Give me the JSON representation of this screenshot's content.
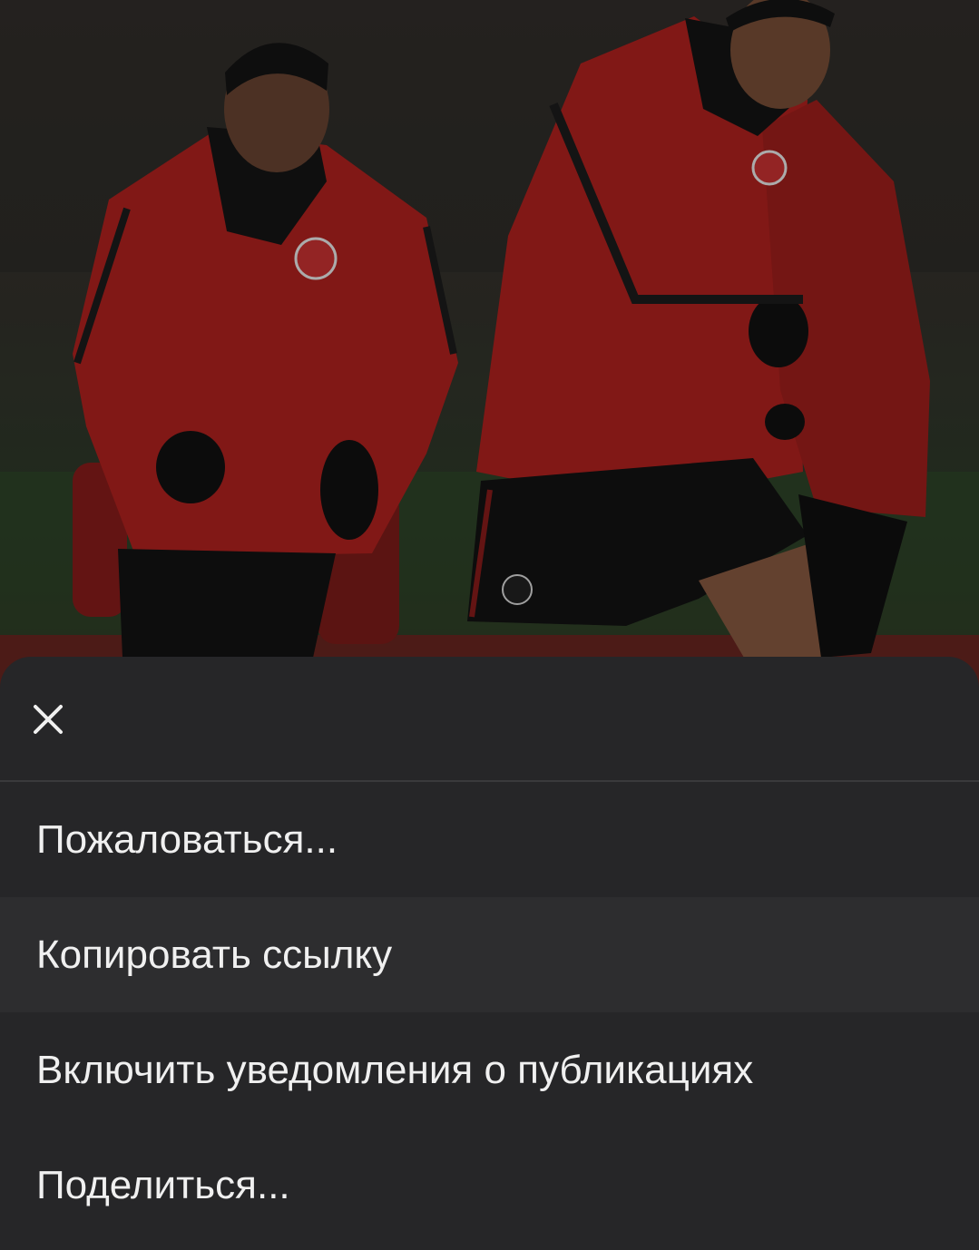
{
  "sheet": {
    "close_icon": "close-icon",
    "items": [
      {
        "label": "Пожаловаться..."
      },
      {
        "label": "Копировать ссылку"
      },
      {
        "label": "Включить уведомления о публикациях"
      },
      {
        "label": "Поделиться..."
      }
    ]
  },
  "colors": {
    "sheet_background": "#262628",
    "text": "#f0f0f0",
    "highlight": "#2d2d2f",
    "jacket_red": "#b3221f"
  }
}
